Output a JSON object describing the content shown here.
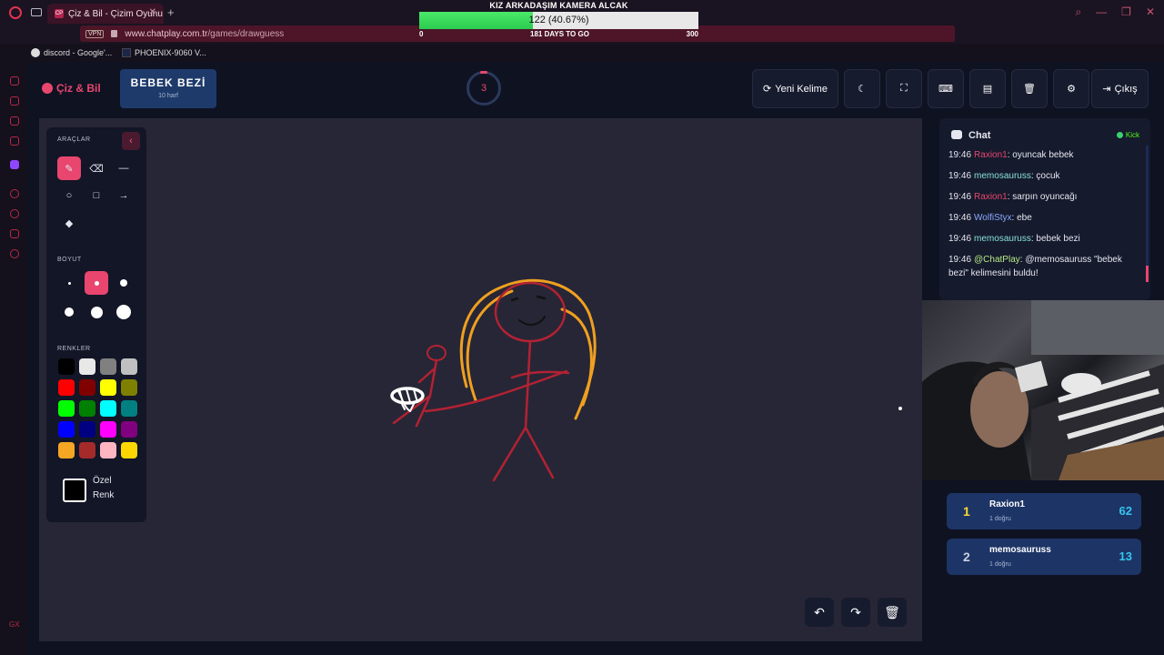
{
  "browser": {
    "tab_title": "Çiz & Bil - Çizim Oyunu",
    "tab_favicon": "CP",
    "url_host": "www.chatplay.com.tr",
    "url_path": "/games/drawguess",
    "vpn_badge": "VPN",
    "ai_label": "AI",
    "bookmarks": [
      "discord - Google'...",
      "PHOENIX-9060 V..."
    ]
  },
  "overlay": {
    "title": "KIZ ARKADAŞIM KAMERA ALCAK",
    "progress_text": "122 (40.67%)",
    "progress_fraction": 0.4067,
    "min": "0",
    "days_text": "181 DAYS TO GO",
    "max": "300"
  },
  "header": {
    "brand": "Çiz & Bil",
    "word": "BEBEK BEZİ",
    "word_sub": "10 harf",
    "timer": "3",
    "new_word_label": "Yeni Kelime",
    "exit_label": "Çıkış"
  },
  "toolbox": {
    "tools_label": "ARAÇLAR",
    "size_label": "BOYUT",
    "colors_label": "RENKLER",
    "custom_color_line1": "Özel",
    "custom_color_line2": "Renk",
    "colors": [
      "#000000",
      "#e8e8e8",
      "#808080",
      "#c0c0c0",
      "#ff0000",
      "#800000",
      "#ffff00",
      "#808000",
      "#00ff00",
      "#008000",
      "#00ffff",
      "#008080",
      "#0000ff",
      "#000080",
      "#ff00ff",
      "#800080",
      "#f5a623",
      "#a52a2a",
      "#ffb6c1",
      "#ffd700"
    ]
  },
  "chat": {
    "title": "Chat",
    "platform": "Kick",
    "messages": [
      {
        "time": "19:46",
        "user": "Raxion1",
        "user_color": "#e8466e",
        "text": ": oyuncak bebek"
      },
      {
        "time": "19:46",
        "user": "memosauruss",
        "user_color": "#86e0d8",
        "text": ": çocuk"
      },
      {
        "time": "19:46",
        "user": "Raxion1",
        "user_color": "#e8466e",
        "text": ": sarpın oyuncağı"
      },
      {
        "time": "19:46",
        "user": "WolfiStyx",
        "user_color": "#8aa8ff",
        "text": ": ebe"
      },
      {
        "time": "19:46",
        "user": "memosauruss",
        "user_color": "#86e0d8",
        "text": ": bebek bezi"
      },
      {
        "time": "19:46",
        "user": "@ChatPlay",
        "user_color": "#b8e986",
        "text": ": @memosauruss \"bebek bezi\" kelimesini buldu!"
      }
    ]
  },
  "leaderboard": [
    {
      "rank": "1",
      "rank_color": "#f8d82c",
      "name": "Raxion1",
      "sub": "1 doğru",
      "score": "62"
    },
    {
      "rank": "2",
      "rank_color": "#c8cfe0",
      "name": "memosauruss",
      "sub": "1 doğru",
      "score": "13"
    }
  ]
}
